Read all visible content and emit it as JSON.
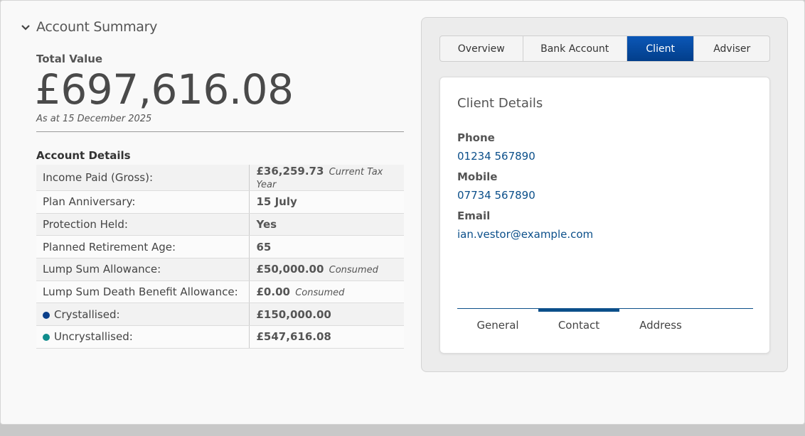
{
  "summary": {
    "title": "Account Summary",
    "total_label": "Total Value",
    "total_value": "£697,616.08",
    "as_at": "As at 15 December 2025"
  },
  "details": {
    "heading": "Account Details",
    "rows": [
      {
        "label": "Income Paid (Gross):",
        "value": "£36,259.73",
        "note": "Current Tax Year"
      },
      {
        "label": "Plan Anniversary:",
        "value": "15 July",
        "note": ""
      },
      {
        "label": "Protection Held:",
        "value": "Yes",
        "note": ""
      },
      {
        "label": "Planned Retirement Age:",
        "value": "65",
        "note": ""
      },
      {
        "label": "Lump Sum Allowance:",
        "value": "£50,000.00",
        "note": "Consumed"
      },
      {
        "label": "Lump Sum Death Benefit Allowance:",
        "value": "£0.00",
        "note": "Consumed"
      },
      {
        "label": "Crystallised:",
        "value": "£150,000.00",
        "note": "",
        "dot_color": "#0b3f8a"
      },
      {
        "label": "Uncrystallised:",
        "value": "£547,616.08",
        "note": "",
        "dot_color": "#0f8c8c"
      }
    ]
  },
  "tabs": [
    {
      "label": "Overview",
      "active": false
    },
    {
      "label": "Bank Account",
      "active": false
    },
    {
      "label": "Client",
      "active": true
    },
    {
      "label": "Adviser",
      "active": false
    }
  ],
  "client": {
    "title": "Client Details",
    "phone_label": "Phone",
    "phone": "01234 567890",
    "mobile_label": "Mobile",
    "mobile": "07734 567890",
    "email_label": "Email",
    "email": "ian.vestor@example.com"
  },
  "subtabs": [
    {
      "label": "General",
      "active": false
    },
    {
      "label": "Contact",
      "active": true
    },
    {
      "label": "Address",
      "active": false
    }
  ],
  "colors": {
    "accent": "#0b4f8a",
    "active_tab": "#023e8a"
  }
}
